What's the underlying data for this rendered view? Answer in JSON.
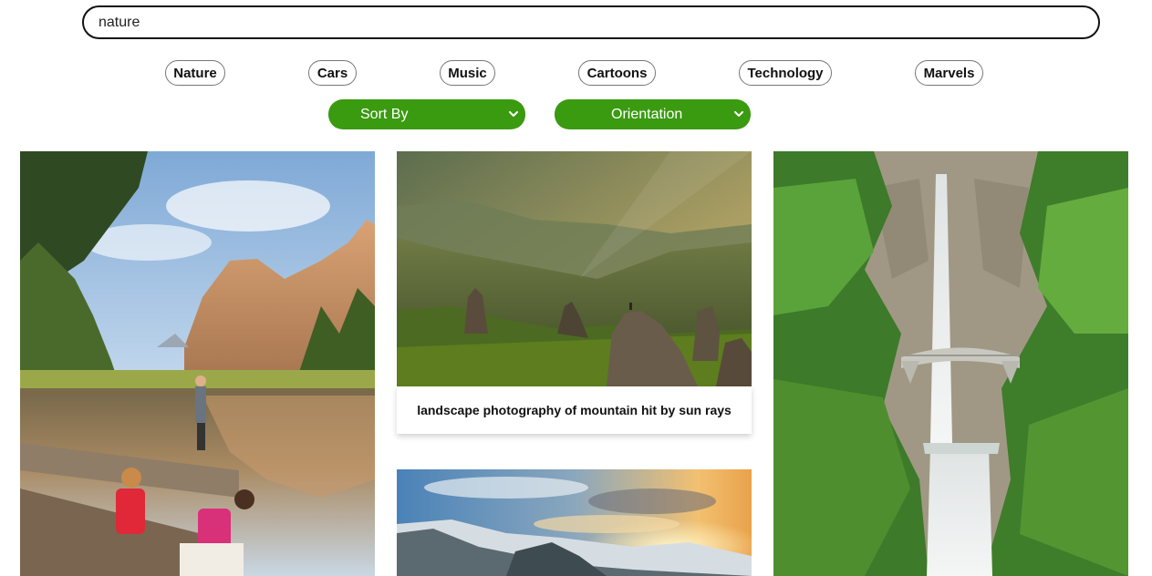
{
  "search": {
    "value": "nature"
  },
  "categories": [
    {
      "label": "Nature"
    },
    {
      "label": "Cars"
    },
    {
      "label": "Music"
    },
    {
      "label": "Cartoons"
    },
    {
      "label": "Technology"
    },
    {
      "label": "Marvels"
    }
  ],
  "filters": {
    "sort_by": {
      "label": "Sort By",
      "icon": "chevron-down-icon"
    },
    "orientation": {
      "label": "Orientation",
      "icon": "chevron-down-icon"
    }
  },
  "colors": {
    "accent": "#3a9a10",
    "chip_border": "#777777",
    "search_border": "#111111"
  },
  "gallery": {
    "photos": [
      {
        "subject": "yosemite-lake-hikers"
      },
      {
        "subject": "mountain-sun-rays",
        "caption": "landscape photography of mountain hit by sun rays"
      },
      {
        "subject": "waterfall-bridge"
      },
      {
        "subject": "cloudy-sunset-mountains"
      }
    ]
  }
}
